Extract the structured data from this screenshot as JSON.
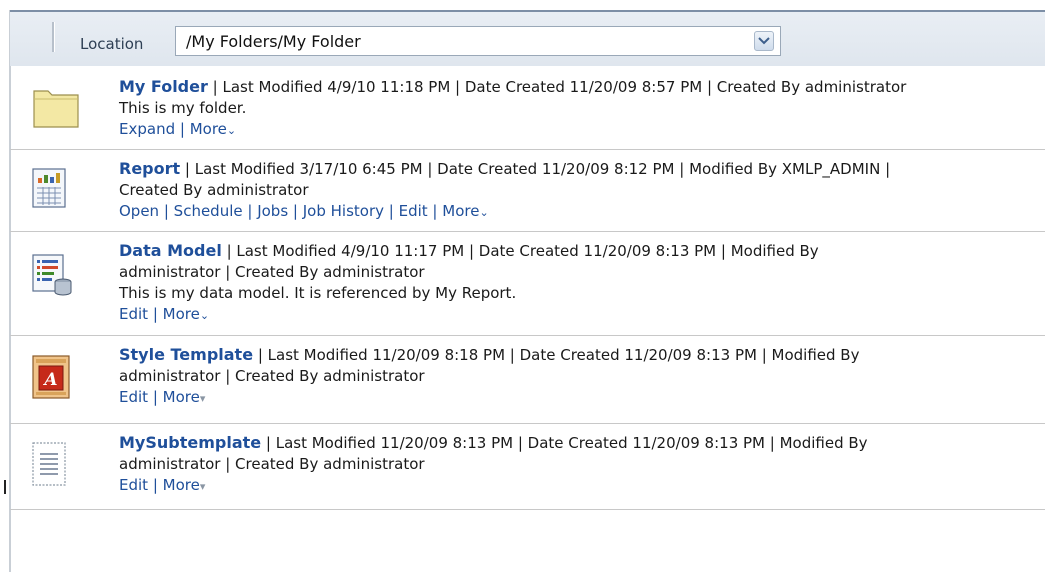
{
  "location": {
    "label": "Location",
    "value": "/My Folders/My Folder"
  },
  "items": [
    {
      "title": "My Folder",
      "meta_line1": " | Last Modified 4/9/10 11:18 PM | Date Created 11/20/09 8:57 PM | Created By administrator",
      "meta_line2": "",
      "description": "This is my folder.",
      "links": [
        "Expand",
        "More"
      ]
    },
    {
      "title": "Report",
      "meta_line1": " | Last Modified 3/17/10 6:45 PM | Date Created 11/20/09 8:12 PM | Modified By XMLP_ADMIN |",
      "meta_line2": "Created By administrator",
      "description": "",
      "links": [
        "Open",
        "Schedule",
        "Jobs",
        "Job History",
        "Edit",
        "More"
      ]
    },
    {
      "title": "Data Model",
      "meta_line1": " | Last Modified 4/9/10 11:17 PM | Date Created 11/20/09 8:13 PM | Modified By",
      "meta_line2": "administrator | Created By administrator",
      "description": "This is my data model. It is referenced by My Report.",
      "links": [
        "Edit",
        "More"
      ]
    },
    {
      "title": "Style Template",
      "meta_line1": " | Last Modified 11/20/09 8:18 PM | Date Created 11/20/09 8:13 PM | Modified By",
      "meta_line2": "administrator | Created By administrator",
      "description": "",
      "links": [
        "Edit",
        "More"
      ]
    },
    {
      "title": "MySubtemplate",
      "meta_line1": " | Last Modified 11/20/09 8:13 PM | Date Created 11/20/09 8:13 PM | Modified By",
      "meta_line2": "administrator | Created By administrator",
      "description": "",
      "links": [
        "Edit",
        "More"
      ]
    }
  ],
  "icons": [
    "folder-icon",
    "report-icon",
    "data-model-icon",
    "style-template-icon",
    "subtemplate-icon",
    "chevron-down-icon"
  ]
}
